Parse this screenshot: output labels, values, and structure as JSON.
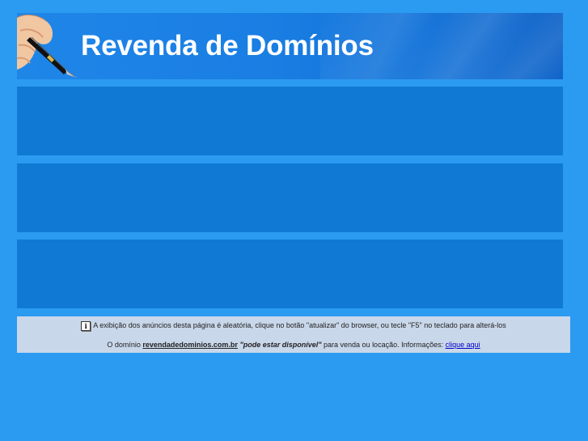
{
  "header": {
    "title": "Revenda de Domínios",
    "image": "hand-with-fountain-pen"
  },
  "ads": [
    {
      "slot": 1
    },
    {
      "slot": 2
    },
    {
      "slot": 3
    }
  ],
  "info": {
    "notice_icon": "info-icon",
    "notice_icon_glyph": "i",
    "notice_text": "A exibição dos anúncios desta página é aleatória, clique no botão \"atualizar\" do browser, ou tecle \"F5\" no teclado para alterá-los",
    "domain_prefix": "O domínio",
    "domain_name": "revendadedominios.com.br",
    "availability": "\"pode estar disponível\"",
    "domain_suffix": "para venda ou locação. Informações:",
    "link_label": "clique aqui"
  },
  "colors": {
    "background": "#2b9bf1",
    "header": "#1a7ee3",
    "ad_block": "#0f79d4",
    "info_bar": "#c9d7ea",
    "link": "#0000cc"
  }
}
